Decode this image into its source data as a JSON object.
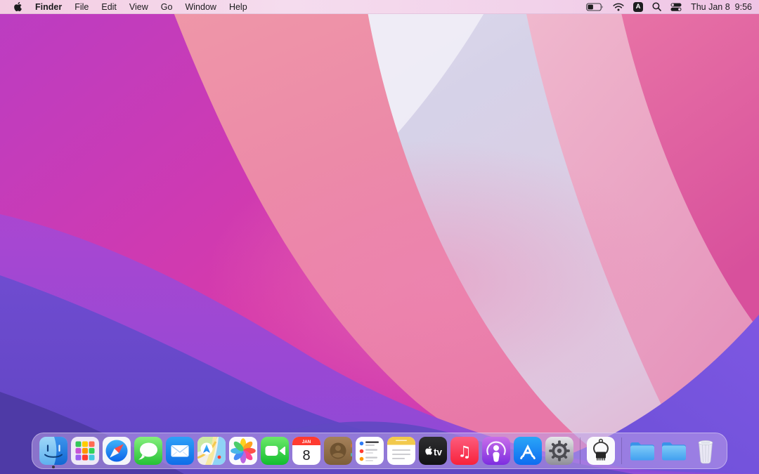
{
  "menu_bar": {
    "app_menu": "Finder",
    "menus": [
      "File",
      "Edit",
      "View",
      "Go",
      "Window",
      "Help"
    ],
    "status_icons": [
      "battery-icon",
      "wifi-icon",
      "keyboard-input-icon",
      "spotlight-search-icon",
      "control-center-icon"
    ],
    "keyboard_input_label": "A",
    "clock": {
      "date": "Thu Jan 8",
      "time": "9:56"
    }
  },
  "dock": {
    "items": [
      {
        "name": "finder",
        "running": true
      },
      {
        "name": "launchpad"
      },
      {
        "name": "safari"
      },
      {
        "name": "messages"
      },
      {
        "name": "mail"
      },
      {
        "name": "maps"
      },
      {
        "name": "photos"
      },
      {
        "name": "facetime"
      },
      {
        "name": "calendar"
      },
      {
        "name": "contacts"
      },
      {
        "name": "reminders"
      },
      {
        "name": "notes"
      },
      {
        "name": "apple-tv"
      },
      {
        "name": "music"
      },
      {
        "name": "podcasts"
      },
      {
        "name": "app-store"
      },
      {
        "name": "system-preferences"
      },
      {
        "name": "chip-utility"
      },
      {
        "name": "folder-1"
      },
      {
        "name": "folder-2"
      },
      {
        "name": "trash"
      }
    ],
    "calendar_glyph": {
      "month": "JAN",
      "day": "8"
    },
    "tv_label": "tv",
    "music_note_glyph": "♫"
  },
  "wallpaper": {
    "palette": [
      "#d83aab",
      "#e25f9f",
      "#ef97a8",
      "#d8d4ea",
      "#8a4ad8",
      "#6d4ace",
      "#4e3aa6"
    ]
  }
}
